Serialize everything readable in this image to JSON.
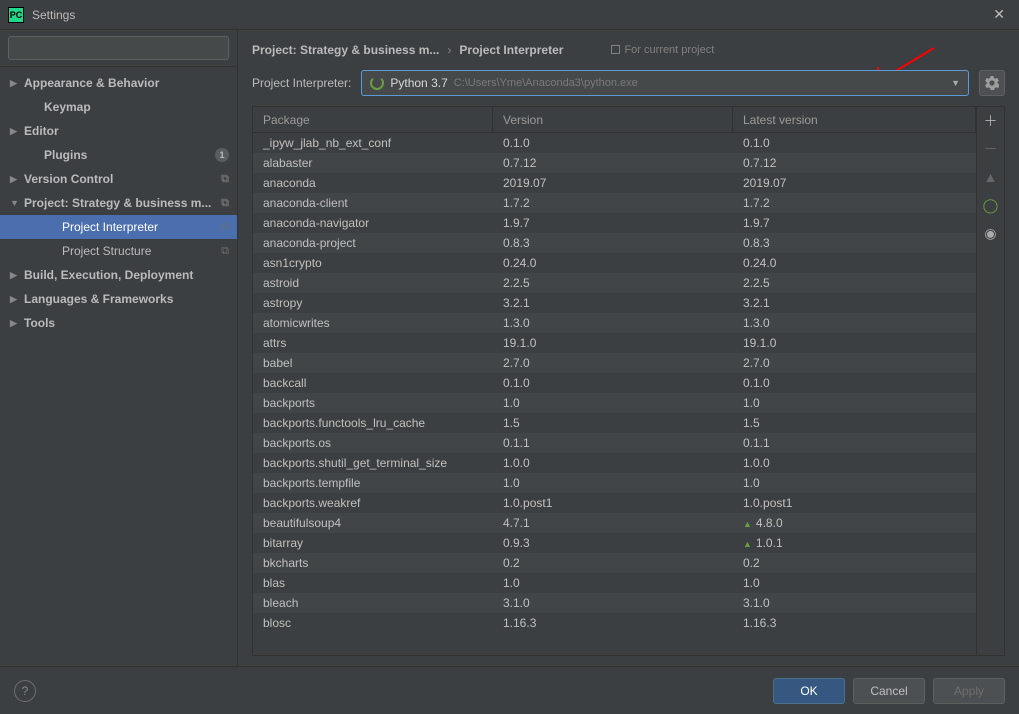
{
  "window": {
    "title": "Settings"
  },
  "search": {
    "placeholder": ""
  },
  "sidebar": {
    "items": [
      {
        "label": "Appearance & Behavior",
        "arrow": "▶",
        "bold": true
      },
      {
        "label": "Keymap",
        "arrow": "",
        "bold": true,
        "indent": 1
      },
      {
        "label": "Editor",
        "arrow": "▶",
        "bold": true
      },
      {
        "label": "Plugins",
        "arrow": "",
        "bold": true,
        "indent": 1,
        "badge": "1"
      },
      {
        "label": "Version Control",
        "arrow": "▶",
        "bold": true,
        "copy": true
      },
      {
        "label": "Project: Strategy & business m...",
        "arrow": "▼",
        "bold": true,
        "copy": true
      },
      {
        "label": "Project Interpreter",
        "arrow": "",
        "indent": 2,
        "selected": true,
        "copy": true
      },
      {
        "label": "Project Structure",
        "arrow": "",
        "indent": 2,
        "copy": true
      },
      {
        "label": "Build, Execution, Deployment",
        "arrow": "▶",
        "bold": true
      },
      {
        "label": "Languages & Frameworks",
        "arrow": "▶",
        "bold": true
      },
      {
        "label": "Tools",
        "arrow": "▶",
        "bold": true
      }
    ]
  },
  "breadcrumb": {
    "part1": "Project: Strategy & business m...",
    "sep": "›",
    "part2": "Project Interpreter",
    "hint": "For current project"
  },
  "interpreter": {
    "label": "Project Interpreter:",
    "version": "Python 3.7",
    "path": "C:\\Users\\Yme\\Anaconda3\\python.exe"
  },
  "columns": {
    "pkg": "Package",
    "ver": "Version",
    "lat": "Latest version"
  },
  "packages": [
    {
      "name": "_ipyw_jlab_nb_ext_conf",
      "version": "0.1.0",
      "latest": "0.1.0"
    },
    {
      "name": "alabaster",
      "version": "0.7.12",
      "latest": "0.7.12"
    },
    {
      "name": "anaconda",
      "version": "2019.07",
      "latest": "2019.07"
    },
    {
      "name": "anaconda-client",
      "version": "1.7.2",
      "latest": "1.7.2"
    },
    {
      "name": "anaconda-navigator",
      "version": "1.9.7",
      "latest": "1.9.7"
    },
    {
      "name": "anaconda-project",
      "version": "0.8.3",
      "latest": "0.8.3"
    },
    {
      "name": "asn1crypto",
      "version": "0.24.0",
      "latest": "0.24.0"
    },
    {
      "name": "astroid",
      "version": "2.2.5",
      "latest": "2.2.5"
    },
    {
      "name": "astropy",
      "version": "3.2.1",
      "latest": "3.2.1"
    },
    {
      "name": "atomicwrites",
      "version": "1.3.0",
      "latest": "1.3.0"
    },
    {
      "name": "attrs",
      "version": "19.1.0",
      "latest": "19.1.0"
    },
    {
      "name": "babel",
      "version": "2.7.0",
      "latest": "2.7.0"
    },
    {
      "name": "backcall",
      "version": "0.1.0",
      "latest": "0.1.0"
    },
    {
      "name": "backports",
      "version": "1.0",
      "latest": "1.0"
    },
    {
      "name": "backports.functools_lru_cache",
      "version": "1.5",
      "latest": "1.5"
    },
    {
      "name": "backports.os",
      "version": "0.1.1",
      "latest": "0.1.1"
    },
    {
      "name": "backports.shutil_get_terminal_size",
      "version": "1.0.0",
      "latest": "1.0.0"
    },
    {
      "name": "backports.tempfile",
      "version": "1.0",
      "latest": "1.0"
    },
    {
      "name": "backports.weakref",
      "version": "1.0.post1",
      "latest": "1.0.post1"
    },
    {
      "name": "beautifulsoup4",
      "version": "4.7.1",
      "latest": "4.8.0",
      "upgrade": true
    },
    {
      "name": "bitarray",
      "version": "0.9.3",
      "latest": "1.0.1",
      "upgrade": true
    },
    {
      "name": "bkcharts",
      "version": "0.2",
      "latest": "0.2"
    },
    {
      "name": "blas",
      "version": "1.0",
      "latest": "1.0"
    },
    {
      "name": "bleach",
      "version": "3.1.0",
      "latest": "3.1.0"
    },
    {
      "name": "blosc",
      "version": "1.16.3",
      "latest": "1.16.3"
    }
  ],
  "buttons": {
    "ok": "OK",
    "cancel": "Cancel",
    "apply": "Apply"
  }
}
